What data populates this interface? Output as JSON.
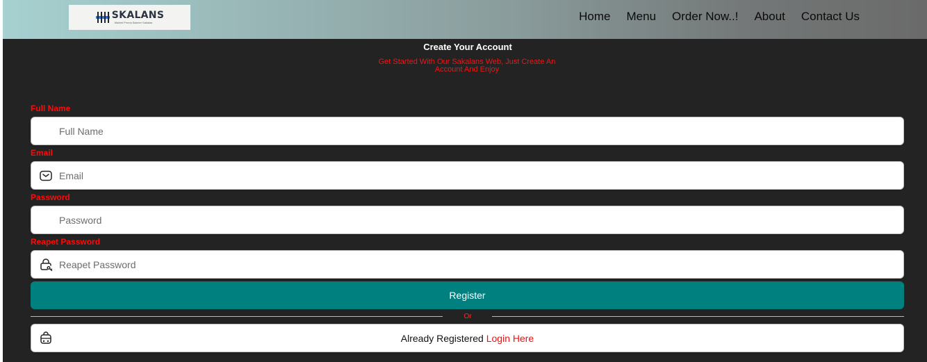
{
  "brand": {
    "name": "SKALANS",
    "tagline": "Market Promo Banner Sakalas"
  },
  "nav": {
    "home": "Home",
    "menu": "Menu",
    "order": "Order Now..!",
    "about": "About",
    "contact": "Contact Us"
  },
  "header": {
    "title": "Create Your Account",
    "subtitle": "Get Started With Our Sakalans Web, Just Create An Account And Enjoy"
  },
  "form": {
    "full_name": {
      "label": "Full Name",
      "placeholder": "Full Name",
      "value": ""
    },
    "email": {
      "label": "Email",
      "placeholder": "Email",
      "value": "",
      "icon": "mail-icon"
    },
    "password": {
      "label": "Password",
      "placeholder": "Password",
      "value": ""
    },
    "repeat_password": {
      "label": "Reapet Password",
      "placeholder": "Reapet Password",
      "value": "",
      "icon": "lock-key-icon"
    },
    "register_label": "Register",
    "divider_text": "Or"
  },
  "login": {
    "prefix": "Already Registered ",
    "link_label": "Login Here",
    "icon": "bag-icon"
  },
  "colors": {
    "accent": "#018080",
    "label": "#ff0a0a",
    "background": "#232323"
  }
}
